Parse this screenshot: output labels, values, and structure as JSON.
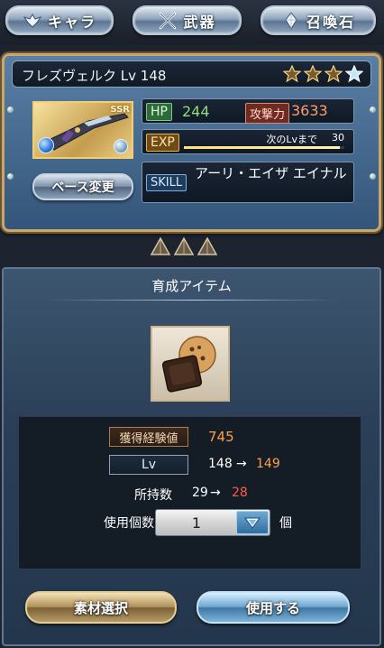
{
  "top_tabs": {
    "chara": "キャラ",
    "weapon": "武器",
    "summon": "召喚石"
  },
  "weapon": {
    "name": "フレズヴェルク Lv 148",
    "rarity_badge": "SSR",
    "stars_filled": 3,
    "stars_total": 4,
    "base_change_label": "ベース変更",
    "hp_label": "HP",
    "hp_value": "244",
    "atk_label": "攻撃力",
    "atk_value": "3633",
    "exp_label": "EXP",
    "exp_next_label": "次のLvまで",
    "exp_next_value": "30",
    "exp_progress_fraction": 0.97,
    "skill_label": "SKILL",
    "skill_name": "アーリ・エイザ エイナル",
    "uncap_count": 3
  },
  "item_panel": {
    "title": "育成アイテム",
    "exp_gain_label": "獲得経験値",
    "exp_gain_value": "745",
    "lv_label": "Lv",
    "lv_from": "148",
    "lv_arrow": "→",
    "lv_to": "149",
    "owned_label": "所持数",
    "owned_from": "29",
    "owned_arrow": "→",
    "owned_to": "28",
    "use_count_label": "使用個数",
    "use_count_value": "1",
    "use_count_unit": "個",
    "material_select_label": "素材選択",
    "use_label": "使用する"
  },
  "colors": {
    "accent_gold": "#c9a76a",
    "hp_green": "#8fdc7a",
    "atk_orange": "#ff9c6b",
    "gain_orange": "#ffa04a",
    "decrease_red": "#ff5a4a"
  },
  "icons": {
    "chara_tab": "wing-emblem-icon",
    "weapon_tab": "crossed-swords-icon",
    "summon_tab": "crystal-icon",
    "star": "star-icon",
    "uncap": "pyramid-icon",
    "dropdown": "chevron-down-icon"
  }
}
